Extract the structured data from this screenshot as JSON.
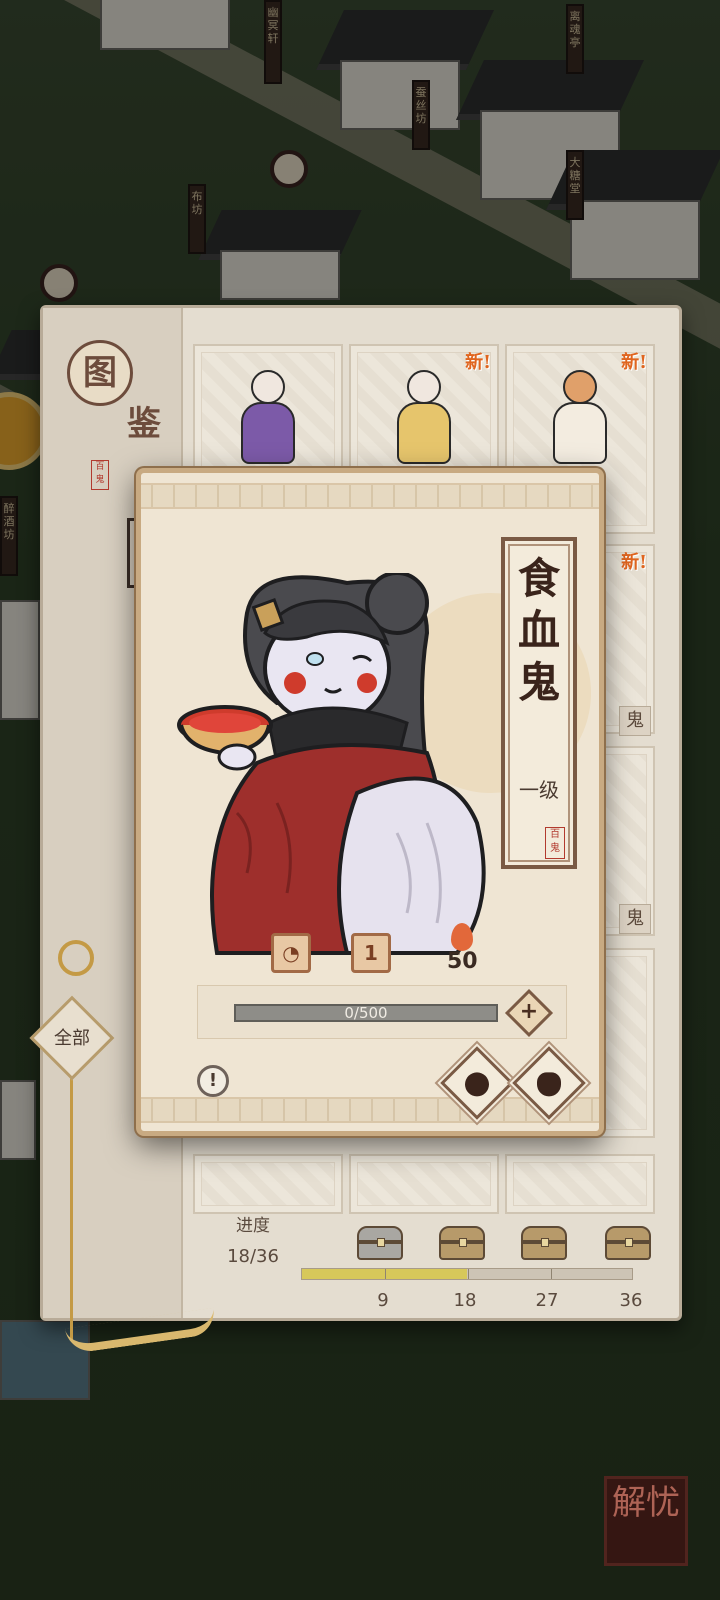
{
  "background": {
    "signs": [
      "幽冥轩",
      "蚕丝坊",
      "离魂亭",
      "大糖堂",
      "布坊",
      "醉酒坊"
    ]
  },
  "book": {
    "title_char_1": "图",
    "title_char_2": "鉴",
    "title_stamp": "百鬼",
    "new_tag": "新!",
    "card_names": [
      "鬼",
      "鬼"
    ],
    "filter_label": "全部",
    "progress": {
      "label": "进度",
      "count": "18/36",
      "collected": 18,
      "total": 36,
      "milestones": [
        "9",
        "18",
        "27",
        "36"
      ]
    }
  },
  "popup": {
    "character_name": "食血鬼",
    "level": "一级",
    "name_stamp": "百鬼",
    "stat_level_value": "1",
    "stat_fire_value": "50",
    "exp_text": "0/500",
    "exp_current": 0,
    "exp_max": 500,
    "info_icon": "!",
    "plus_icon": "+"
  },
  "corner_stamp": "解忧",
  "colors": {
    "accent_new": "#e0651f",
    "progress_fill": "#d7c85a",
    "frame": "#7a5a44",
    "robe": "#9e2f2c"
  },
  "icons": [
    "coin-icon",
    "knot-icon",
    "chest-icon",
    "element-icon",
    "level-badge-icon",
    "flame-icon",
    "info-icon",
    "plus-icon",
    "fire-skill-icon",
    "bag-icon"
  ]
}
